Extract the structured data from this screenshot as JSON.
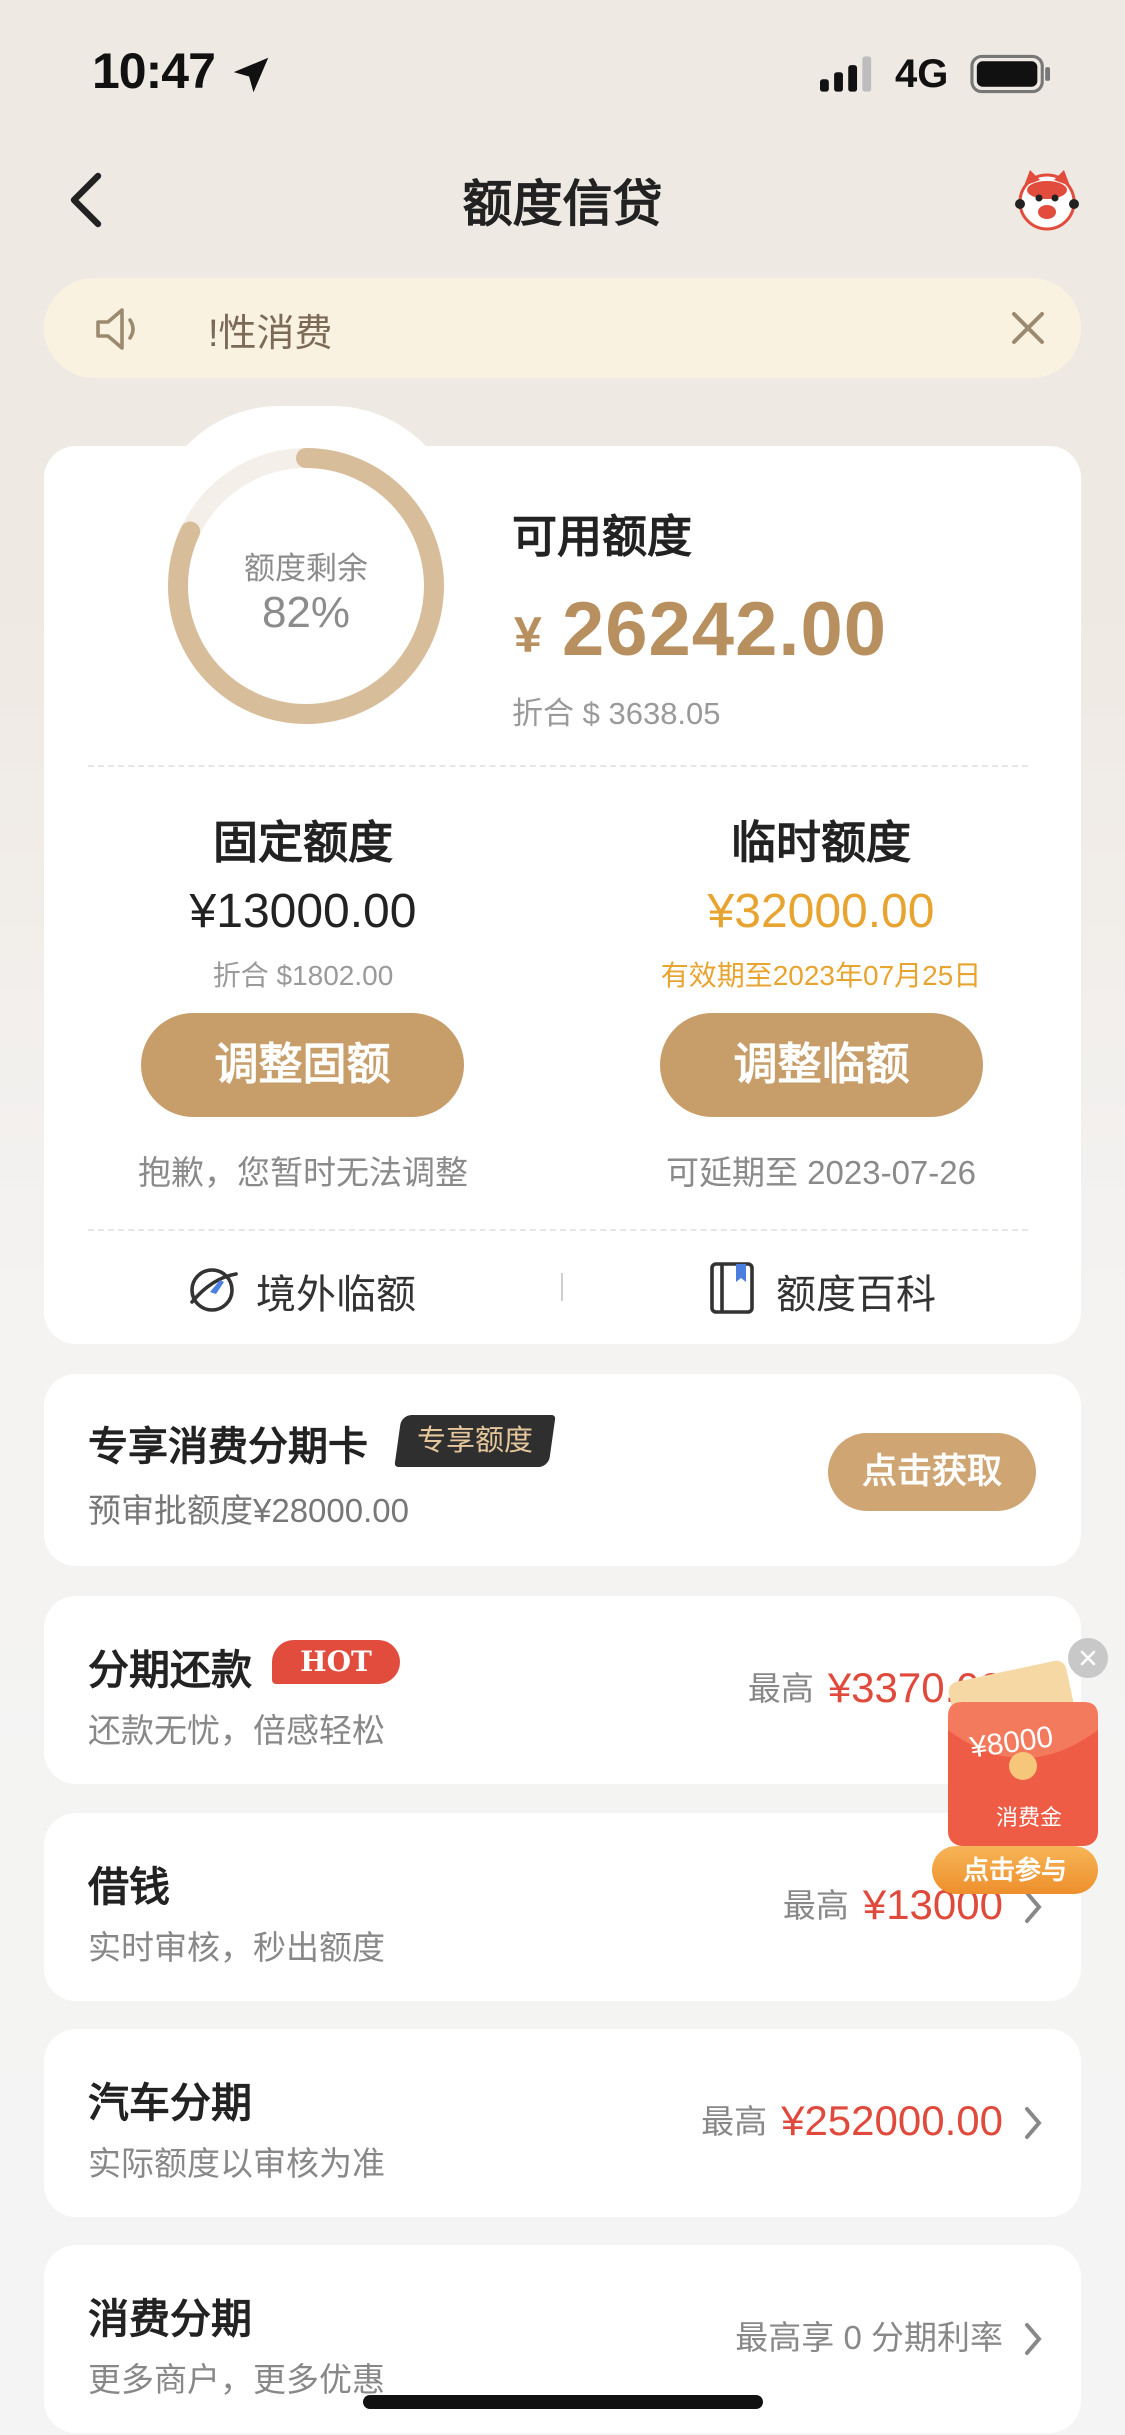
{
  "status_bar": {
    "time": "10:47",
    "network": "4G"
  },
  "nav": {
    "title": "额度信贷"
  },
  "notice": {
    "text": "!性消费"
  },
  "summary": {
    "ring_label": "额度剩余",
    "ring_percent": "82%",
    "ring_fraction": 0.82,
    "available_title": "可用额度",
    "available_currency": "¥",
    "available_amount": "26242.00",
    "available_convert": "折合 $ 3638.05"
  },
  "fixed": {
    "title": "固定额度",
    "amount": "¥13000.00",
    "convert": "折合 $1802.00",
    "button": "调整固额",
    "note": "抱歉，您暂时无法调整"
  },
  "temporary": {
    "title": "临时额度",
    "amount": "¥32000.00",
    "validity": "有效期至2023年07月25日",
    "button": "调整临额",
    "note": "可延期至 2023-07-26"
  },
  "links": {
    "overseas": "境外临额",
    "wiki": "额度百科"
  },
  "exclusive": {
    "title": "专享消费分期卡",
    "badge": "专享额度",
    "subtitle": "预审批额度¥28000.00",
    "button": "点击获取"
  },
  "products": [
    {
      "title": "分期还款",
      "badge": "HOT",
      "subtitle": "还款无忧，倍感轻松",
      "prefix": "最高",
      "amount": "¥3370.00"
    },
    {
      "title": "借钱",
      "subtitle": "实时审核，秒出额度",
      "prefix": "最高",
      "amount": "¥13000"
    },
    {
      "title": "汽车分期",
      "subtitle": "实际额度以审核为准",
      "prefix": "最高",
      "amount": "¥252000.00"
    },
    {
      "title": "消费分期",
      "subtitle": "更多商户，更多优惠",
      "prefix": "最高享 0 分期利率",
      "amount": ""
    }
  ],
  "promo": {
    "amount": "¥8000",
    "tag": "消费金",
    "button": "点击参与"
  },
  "colors": {
    "gold": "#c79d6a",
    "accent_red": "#e04a3c",
    "temp_orange": "#e8a430"
  }
}
